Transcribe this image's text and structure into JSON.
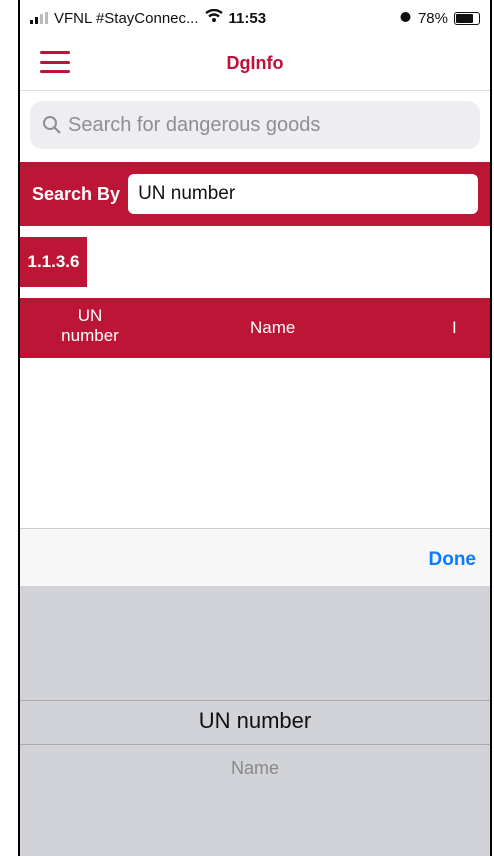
{
  "status_bar": {
    "carrier": "VFNL #StayConnec...",
    "time": "11:53",
    "battery": "78%"
  },
  "nav": {
    "title": "DgInfo"
  },
  "search": {
    "placeholder": "Search for dangerous goods"
  },
  "search_by": {
    "label": "Search By",
    "value": "UN number"
  },
  "tag": "1.1.3.6",
  "table": {
    "col1": "UN number",
    "col2": "Name",
    "col3": "I"
  },
  "toolbar": {
    "done_label": "Done"
  },
  "picker": {
    "selected": "UN number",
    "next": "Name"
  }
}
